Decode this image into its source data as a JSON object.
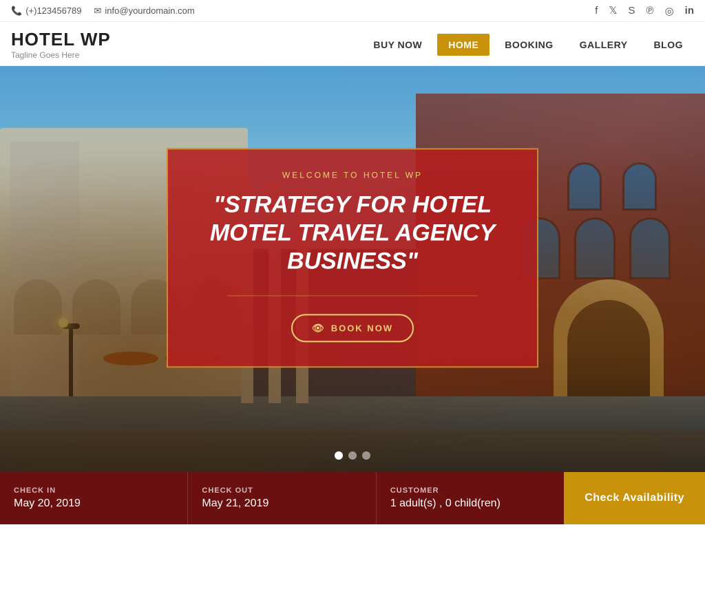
{
  "topbar": {
    "phone": "(+)123456789",
    "email": "info@yourdomain.com",
    "phone_icon": "📞",
    "email_icon": "✉"
  },
  "social": {
    "facebook": "f",
    "twitter": "t",
    "skype": "S",
    "pinterest": "p",
    "instagram": "◎",
    "linkedin": "in"
  },
  "logo": {
    "title": "HOTEL WP",
    "tagline": "Tagline Goes Here"
  },
  "nav": {
    "items": [
      {
        "label": "BUY NOW",
        "active": false
      },
      {
        "label": "HOME",
        "active": true
      },
      {
        "label": "BOOKING",
        "active": false
      },
      {
        "label": "GALLERY",
        "active": false
      },
      {
        "label": "BLOG",
        "active": false
      }
    ]
  },
  "hero": {
    "subtitle": "WELCOME TO HOTEL WP",
    "title": "\"STRATEGY FOR HOTEL MOTEL TRAVEL AGENCY BUSINESS\"",
    "book_button": "BOOK NOW",
    "dots": [
      1,
      2,
      3
    ],
    "active_dot": 1
  },
  "booking": {
    "checkin_label": "CHECK IN",
    "checkin_value": "May 20, 2019",
    "checkout_label": "CHECK OUT",
    "checkout_value": "May 21, 2019",
    "customer_label": "CUSTOMER",
    "customer_value": "1 adult(s) , 0 child(ren)",
    "button_label": "Check Availability"
  }
}
